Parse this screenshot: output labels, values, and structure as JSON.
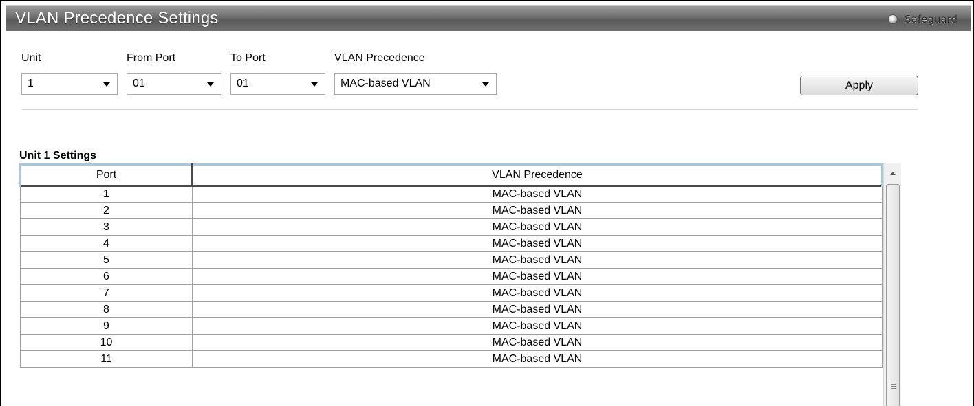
{
  "header": {
    "title": "VLAN Precedence Settings",
    "safeguard_label": "Safeguard"
  },
  "form": {
    "unit": {
      "label": "Unit",
      "value": "1"
    },
    "from_port": {
      "label": "From Port",
      "value": "01"
    },
    "to_port": {
      "label": "To Port",
      "value": "01"
    },
    "vlan_precedence": {
      "label": "VLAN Precedence",
      "value": "MAC-based VLAN"
    },
    "apply_label": "Apply"
  },
  "table": {
    "section_title": "Unit 1 Settings",
    "columns": [
      "Port",
      "VLAN Precedence"
    ],
    "rows": [
      {
        "port": "1",
        "precedence": "MAC-based VLAN"
      },
      {
        "port": "2",
        "precedence": "MAC-based VLAN"
      },
      {
        "port": "3",
        "precedence": "MAC-based VLAN"
      },
      {
        "port": "4",
        "precedence": "MAC-based VLAN"
      },
      {
        "port": "5",
        "precedence": "MAC-based VLAN"
      },
      {
        "port": "6",
        "precedence": "MAC-based VLAN"
      },
      {
        "port": "7",
        "precedence": "MAC-based VLAN"
      },
      {
        "port": "8",
        "precedence": "MAC-based VLAN"
      },
      {
        "port": "9",
        "precedence": "MAC-based VLAN"
      },
      {
        "port": "10",
        "precedence": "MAC-based VLAN"
      },
      {
        "port": "11",
        "precedence": "MAC-based VLAN"
      }
    ]
  }
}
